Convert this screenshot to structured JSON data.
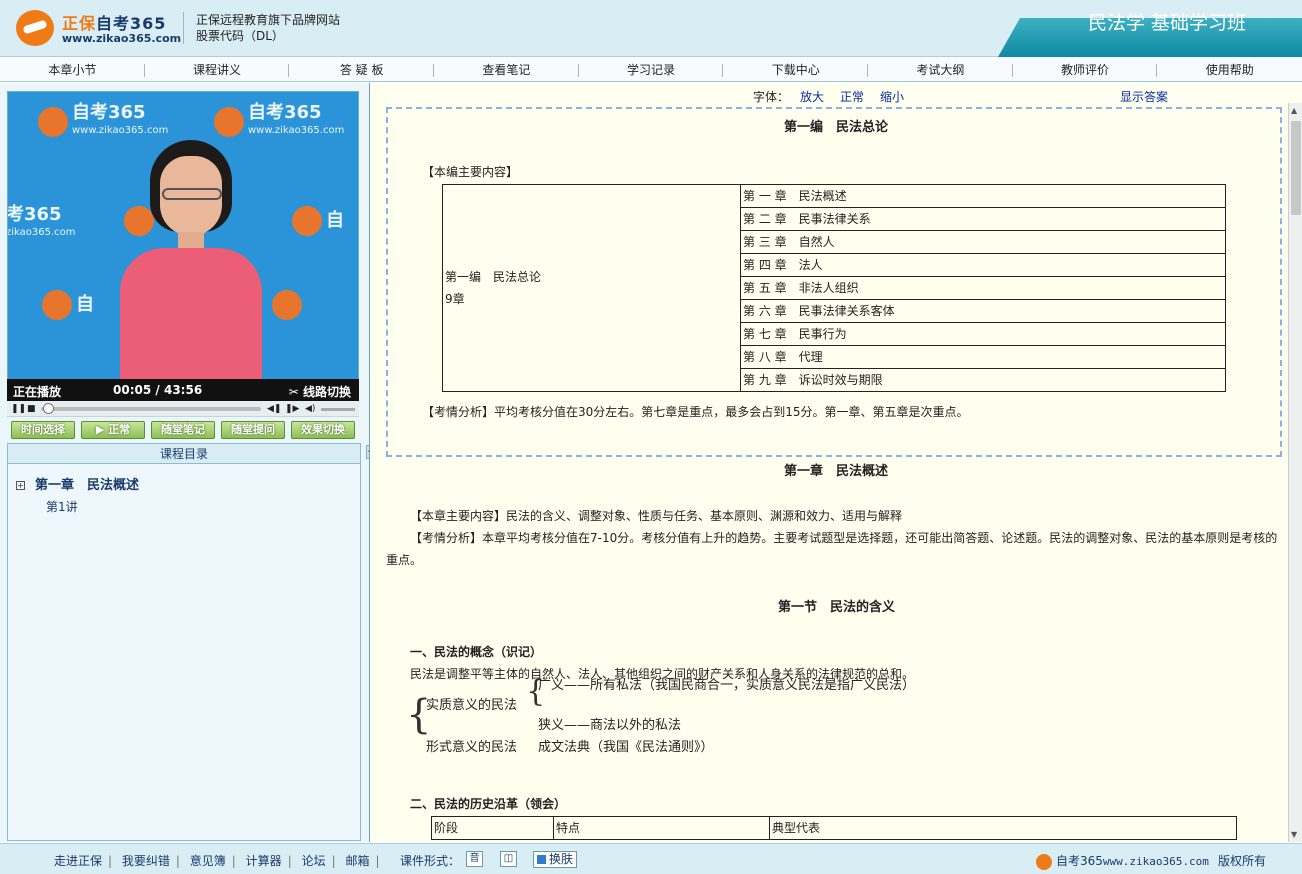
{
  "header": {
    "logo_title_a": "正保",
    "logo_title_b": "自考365",
    "logo_url": "www.zikao365.com",
    "slogan_line1": "正保远程教育旗下品牌网站",
    "slogan_line2": "股票代码（DL）",
    "course_title": "民法学 基础学习班"
  },
  "nav": [
    "本章小节",
    "课程讲义",
    "答 疑 板",
    "查看笔记",
    "学习记录",
    "下载中心",
    "考试大纲",
    "教师评价",
    "使用帮助"
  ],
  "video": {
    "watermark_text": "自考365",
    "watermark_url": "www.zikao365.com",
    "watermark_partial_a": "考365",
    "watermark_partial_url": "zikao365.com",
    "watermark_partial_b": "自",
    "status": "正在播放",
    "time_current": "00:05",
    "time_sep": "/",
    "time_total": "43:56",
    "line_switch": "线路切换",
    "progress": 0.002
  },
  "player_buttons": [
    "时间选择",
    "正常",
    "随堂笔记",
    "随堂提问",
    "效果切换"
  ],
  "catalog": {
    "title": "课程目录",
    "chapter": "第一章　民法概述",
    "expand_symbol": "+",
    "lecture": "第1讲"
  },
  "toolbar": {
    "font_label": "字体：",
    "enlarge": "放大",
    "normal": "正常",
    "shrink": "缩小",
    "show_answer": "显示答案"
  },
  "content": {
    "part_title": "第一编　民法总论",
    "part_main_label": "【本编主要内容】",
    "part_cell_line1": "第一编　民法总论",
    "part_cell_line2": "9章",
    "chapters": [
      "第 一 章　民法概述",
      "第 二 章　民事法律关系",
      "第 三 章　自然人",
      "第 四 章　法人",
      "第 五 章　非法人组织",
      "第 六 章　民事法律关系客体",
      "第 七 章　民事行为",
      "第 八 章　代理",
      "第 九 章　诉讼时效与期限"
    ],
    "part_analysis": "【考情分析】平均考核分值在30分左右。第七章是重点，最多会占到15分。第一章、第五章是次重点。",
    "chapter_title": "第一章　民法概述",
    "chapter_main": "【本章主要内容】民法的含义、调整对象、性质与任务、基本原则、渊源和效力、适用与解释",
    "chapter_analysis_1": "【考情分析】本章平均考核分值在7-10分。考核分值有上升的趋势。主要考试题型是选择题，还可能出简答题、论述题。民法的调整对象、民法的基本原则是考核的",
    "chapter_analysis_2": "重点。",
    "section_title": "第一节　民法的含义",
    "concept_heading": "一、民法的概念（识记）",
    "concept_text": "民法是调整平等主体的自然人、法人、其他组织之间的财产关系和人身关系的法律规范的总和。",
    "tree_substantive": "实质意义的民法",
    "tree_broad": "广义——所有私法（我国民商合一，实质意义民法是指广义民法）",
    "tree_narrow": "狭义——商法以外的私法",
    "tree_formal": "形式意义的民法",
    "tree_formal_desc": "成文法典（我国《民法通则》）",
    "history_heading": "二、民法的历史沿革（领会）",
    "history_table_headers": [
      "阶段",
      "特点",
      "典型代表"
    ]
  },
  "footer": {
    "links": [
      "走进正保",
      "我要纠错",
      "意见簿",
      "计算器",
      "论坛",
      "邮箱"
    ],
    "mode_label": "课件形式：",
    "mode_audio_glyph": "音",
    "skin_label": "换肤",
    "brand_text": "自考365",
    "brand_url": "www.zikao365.com",
    "copyright": "版权所有"
  }
}
